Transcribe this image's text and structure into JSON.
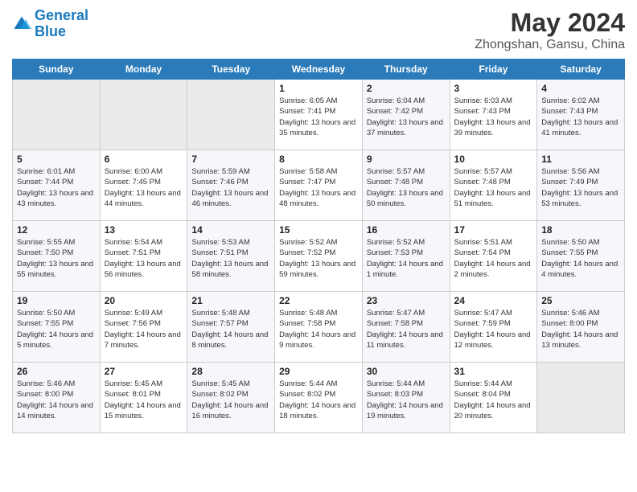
{
  "header": {
    "logo_line1": "General",
    "logo_line2": "Blue",
    "month_year": "May 2024",
    "location": "Zhongshan, Gansu, China"
  },
  "days_of_week": [
    "Sunday",
    "Monday",
    "Tuesday",
    "Wednesday",
    "Thursday",
    "Friday",
    "Saturday"
  ],
  "weeks": [
    [
      {
        "day": "",
        "empty": true
      },
      {
        "day": "",
        "empty": true
      },
      {
        "day": "",
        "empty": true
      },
      {
        "day": "1",
        "sunrise": "6:05 AM",
        "sunset": "7:41 PM",
        "daylight": "13 hours and 35 minutes."
      },
      {
        "day": "2",
        "sunrise": "6:04 AM",
        "sunset": "7:42 PM",
        "daylight": "13 hours and 37 minutes."
      },
      {
        "day": "3",
        "sunrise": "6:03 AM",
        "sunset": "7:43 PM",
        "daylight": "13 hours and 39 minutes."
      },
      {
        "day": "4",
        "sunrise": "6:02 AM",
        "sunset": "7:43 PM",
        "daylight": "13 hours and 41 minutes."
      }
    ],
    [
      {
        "day": "5",
        "sunrise": "6:01 AM",
        "sunset": "7:44 PM",
        "daylight": "13 hours and 43 minutes."
      },
      {
        "day": "6",
        "sunrise": "6:00 AM",
        "sunset": "7:45 PM",
        "daylight": "13 hours and 44 minutes."
      },
      {
        "day": "7",
        "sunrise": "5:59 AM",
        "sunset": "7:46 PM",
        "daylight": "13 hours and 46 minutes."
      },
      {
        "day": "8",
        "sunrise": "5:58 AM",
        "sunset": "7:47 PM",
        "daylight": "13 hours and 48 minutes."
      },
      {
        "day": "9",
        "sunrise": "5:57 AM",
        "sunset": "7:48 PM",
        "daylight": "13 hours and 50 minutes."
      },
      {
        "day": "10",
        "sunrise": "5:57 AM",
        "sunset": "7:48 PM",
        "daylight": "13 hours and 51 minutes."
      },
      {
        "day": "11",
        "sunrise": "5:56 AM",
        "sunset": "7:49 PM",
        "daylight": "13 hours and 53 minutes."
      }
    ],
    [
      {
        "day": "12",
        "sunrise": "5:55 AM",
        "sunset": "7:50 PM",
        "daylight": "13 hours and 55 minutes."
      },
      {
        "day": "13",
        "sunrise": "5:54 AM",
        "sunset": "7:51 PM",
        "daylight": "13 hours and 56 minutes."
      },
      {
        "day": "14",
        "sunrise": "5:53 AM",
        "sunset": "7:51 PM",
        "daylight": "13 hours and 58 minutes."
      },
      {
        "day": "15",
        "sunrise": "5:52 AM",
        "sunset": "7:52 PM",
        "daylight": "13 hours and 59 minutes."
      },
      {
        "day": "16",
        "sunrise": "5:52 AM",
        "sunset": "7:53 PM",
        "daylight": "14 hours and 1 minute."
      },
      {
        "day": "17",
        "sunrise": "5:51 AM",
        "sunset": "7:54 PM",
        "daylight": "14 hours and 2 minutes."
      },
      {
        "day": "18",
        "sunrise": "5:50 AM",
        "sunset": "7:55 PM",
        "daylight": "14 hours and 4 minutes."
      }
    ],
    [
      {
        "day": "19",
        "sunrise": "5:50 AM",
        "sunset": "7:55 PM",
        "daylight": "14 hours and 5 minutes."
      },
      {
        "day": "20",
        "sunrise": "5:49 AM",
        "sunset": "7:56 PM",
        "daylight": "14 hours and 7 minutes."
      },
      {
        "day": "21",
        "sunrise": "5:48 AM",
        "sunset": "7:57 PM",
        "daylight": "14 hours and 8 minutes."
      },
      {
        "day": "22",
        "sunrise": "5:48 AM",
        "sunset": "7:58 PM",
        "daylight": "14 hours and 9 minutes."
      },
      {
        "day": "23",
        "sunrise": "5:47 AM",
        "sunset": "7:58 PM",
        "daylight": "14 hours and 11 minutes."
      },
      {
        "day": "24",
        "sunrise": "5:47 AM",
        "sunset": "7:59 PM",
        "daylight": "14 hours and 12 minutes."
      },
      {
        "day": "25",
        "sunrise": "5:46 AM",
        "sunset": "8:00 PM",
        "daylight": "14 hours and 13 minutes."
      }
    ],
    [
      {
        "day": "26",
        "sunrise": "5:46 AM",
        "sunset": "8:00 PM",
        "daylight": "14 hours and 14 minutes."
      },
      {
        "day": "27",
        "sunrise": "5:45 AM",
        "sunset": "8:01 PM",
        "daylight": "14 hours and 15 minutes."
      },
      {
        "day": "28",
        "sunrise": "5:45 AM",
        "sunset": "8:02 PM",
        "daylight": "14 hours and 16 minutes."
      },
      {
        "day": "29",
        "sunrise": "5:44 AM",
        "sunset": "8:02 PM",
        "daylight": "14 hours and 18 minutes."
      },
      {
        "day": "30",
        "sunrise": "5:44 AM",
        "sunset": "8:03 PM",
        "daylight": "14 hours and 19 minutes."
      },
      {
        "day": "31",
        "sunrise": "5:44 AM",
        "sunset": "8:04 PM",
        "daylight": "14 hours and 20 minutes."
      },
      {
        "day": "",
        "empty": true
      }
    ]
  ]
}
